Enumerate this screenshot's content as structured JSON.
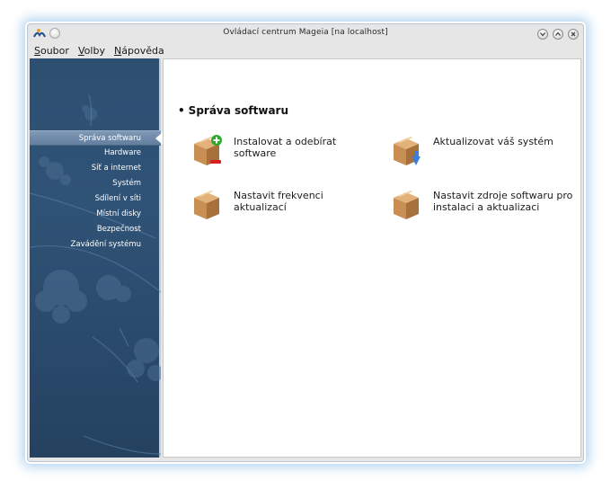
{
  "window": {
    "title": "Ovládací centrum Mageia  [na localhost]"
  },
  "menubar": {
    "items": [
      "Soubor",
      "Volby",
      "Nápověda"
    ]
  },
  "sidebar": {
    "items": [
      {
        "label": "Správa softwaru",
        "active": true
      },
      {
        "label": "Hardware"
      },
      {
        "label": "Síť a internet"
      },
      {
        "label": "Systém"
      },
      {
        "label": "Sdílení v síti"
      },
      {
        "label": "Místní disky"
      },
      {
        "label": "Bezpečnost"
      },
      {
        "label": "Zavádění systému"
      }
    ]
  },
  "main": {
    "section_title": "Správa softwaru",
    "tiles": [
      {
        "label": "Instalovat a odebírat software",
        "icon": "package-install-icon"
      },
      {
        "label": "Aktualizovat váš systém",
        "icon": "package-update-icon"
      },
      {
        "label": "Nastavit frekvenci aktualizací",
        "icon": "package-icon"
      },
      {
        "label": "Nastavit zdroje softwaru pro instalaci a aktualizaci",
        "icon": "package-icon"
      }
    ]
  },
  "colors": {
    "sidebar_bg": "#2d4f72",
    "sidebar_active": "#7e98b5",
    "package_brown": "#c98f52"
  }
}
